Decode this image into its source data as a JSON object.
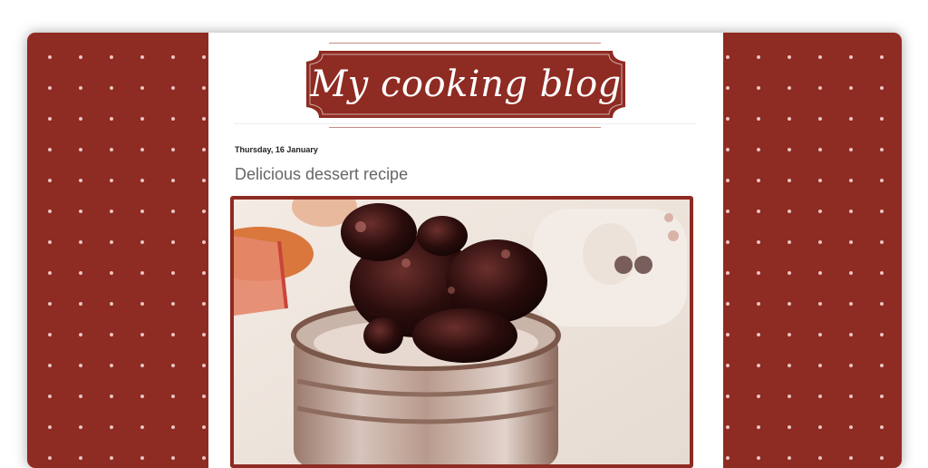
{
  "blog": {
    "title": "My cooking blog"
  },
  "post": {
    "date": "Thursday, 16 January",
    "title": "Delicious dessert recipe"
  },
  "colors": {
    "accent": "#8e2b22",
    "dots": "#f2d2cc",
    "post_title": "#666666"
  },
  "icons": [
    "polka-dot-background"
  ]
}
